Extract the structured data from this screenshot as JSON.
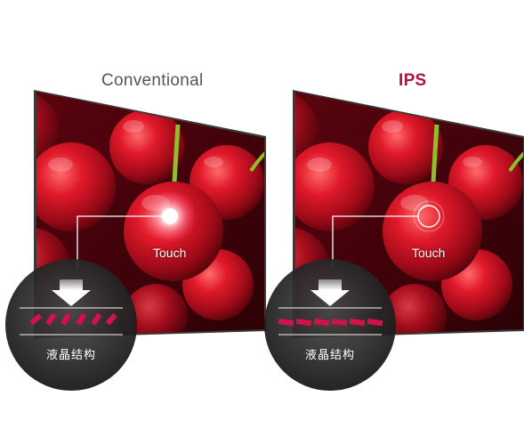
{
  "panels": {
    "left": {
      "title": "Conventional",
      "touch_label": "Touch",
      "structure_label": "液晶结构",
      "crystal_orientation": "tilted"
    },
    "right": {
      "title": "IPS",
      "touch_label": "Touch",
      "structure_label": "液晶结构",
      "crystal_orientation": "horizontal"
    }
  },
  "colors": {
    "title_left": "#555555",
    "title_right": "#b3123f",
    "crystal": "#d4114a",
    "cherry": "#c4101f"
  }
}
